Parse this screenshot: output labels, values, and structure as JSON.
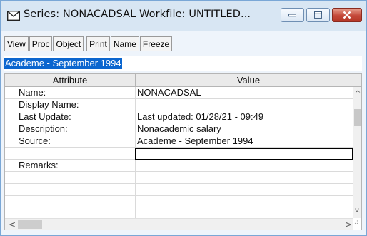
{
  "window": {
    "title": "Series: NONACADSAL   Workfile: UNTITLED...",
    "icon": "series-envelope-icon",
    "controls": {
      "minimize": "minimize-icon",
      "maximize": "maximize-icon",
      "close": "close-icon",
      "close_color": "#c4493a"
    }
  },
  "toolbar": {
    "buttons": [
      "View",
      "Proc",
      "Object",
      "Print",
      "Name",
      "Freeze"
    ]
  },
  "edit_line": {
    "value": "Academe - September 1994",
    "selection_color": "#0b66cf"
  },
  "table": {
    "headers": {
      "attribute": "Attribute",
      "value": "Value"
    },
    "rows": [
      {
        "attribute": "Name:",
        "value": "NONACADSAL"
      },
      {
        "attribute": "Display Name:",
        "value": ""
      },
      {
        "attribute": "Last Update:",
        "value": "Last updated: 01/28/21 - 09:49"
      },
      {
        "attribute": "Description:",
        "value": "Nonacademic salary"
      },
      {
        "attribute": "Source:",
        "value": "Academe - September 1994"
      },
      {
        "attribute": "",
        "value": ""
      },
      {
        "attribute": "Remarks:",
        "value": ""
      },
      {
        "attribute": "",
        "value": ""
      },
      {
        "attribute": "",
        "value": ""
      }
    ]
  },
  "scrollbars": {
    "up": "^",
    "down": "v",
    "left": "<",
    "right": ">",
    "grip": ".:"
  }
}
